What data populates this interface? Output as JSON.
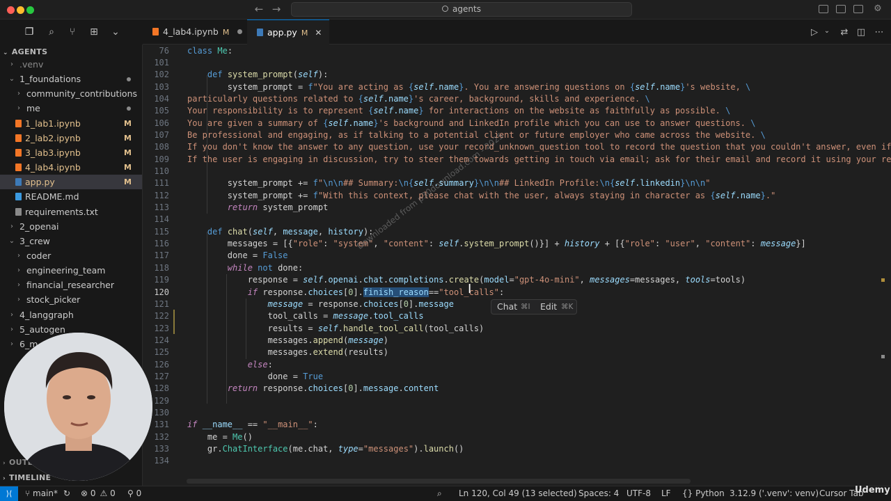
{
  "window": {
    "search_label": "agents"
  },
  "sidebar": {
    "section_title": "AGENTS",
    "outline_label": "OUTL...",
    "timeline_label": "TIMELINE",
    "items": [
      {
        "label": ".venv",
        "depth": 1,
        "kind": "folder",
        "open": false,
        "dim": true
      },
      {
        "label": "1_foundations",
        "depth": 1,
        "kind": "folder",
        "open": true,
        "dot": true
      },
      {
        "label": "community_contributions",
        "depth": 2,
        "kind": "folder",
        "open": false
      },
      {
        "label": "me",
        "depth": 2,
        "kind": "folder",
        "open": false,
        "dot": true
      },
      {
        "label": "1_lab1.ipynb",
        "depth": 2,
        "kind": "notebook",
        "badge": "M"
      },
      {
        "label": "2_lab2.ipynb",
        "depth": 2,
        "kind": "notebook",
        "badge": "M"
      },
      {
        "label": "3_lab3.ipynb",
        "depth": 2,
        "kind": "notebook",
        "badge": "M"
      },
      {
        "label": "4_lab4.ipynb",
        "depth": 2,
        "kind": "notebook",
        "badge": "M"
      },
      {
        "label": "app.py",
        "depth": 2,
        "kind": "python",
        "badge": "M",
        "selected": true
      },
      {
        "label": "README.md",
        "depth": 2,
        "kind": "info"
      },
      {
        "label": "requirements.txt",
        "depth": 2,
        "kind": "text"
      },
      {
        "label": "2_openai",
        "depth": 1,
        "kind": "folder",
        "open": false
      },
      {
        "label": "3_crew",
        "depth": 1,
        "kind": "folder",
        "open": true
      },
      {
        "label": "coder",
        "depth": 2,
        "kind": "folder",
        "open": false
      },
      {
        "label": "engineering_team",
        "depth": 2,
        "kind": "folder",
        "open": false
      },
      {
        "label": "financial_researcher",
        "depth": 2,
        "kind": "folder",
        "open": false
      },
      {
        "label": "stock_picker",
        "depth": 2,
        "kind": "folder",
        "open": false
      },
      {
        "label": "4_langgraph",
        "depth": 1,
        "kind": "folder",
        "open": false
      },
      {
        "label": "5_autogen",
        "depth": 1,
        "kind": "folder",
        "open": false
      },
      {
        "label": "6_m",
        "depth": 1,
        "kind": "folder",
        "open": false
      }
    ]
  },
  "tabs": [
    {
      "label": "4_lab4.ipynb",
      "mod": "M",
      "kind": "notebook",
      "active": false
    },
    {
      "label": "app.py",
      "mod": "M",
      "kind": "python",
      "active": true
    }
  ],
  "hover_hint": {
    "chat": "Chat",
    "chat_key": "⌘I",
    "edit": "Edit",
    "edit_key": "⌘K"
  },
  "watermark": "Downloaded from p30download.com - 2025",
  "status": {
    "branch": "main*",
    "errors": "0",
    "warnings": "0",
    "ports": "0",
    "position": "Ln 120, Col 49 (13 selected)",
    "spaces": "Spaces: 4",
    "encoding": "UTF-8",
    "eol": "LF",
    "language": "Python",
    "interpreter": "3.12.9 ('.venv': venv)",
    "cursor_tab": "Cursor Tab"
  },
  "branding": "Udemy",
  "colors": {
    "accent": "#0078d4",
    "modified": "#e2c08d",
    "editor_bg": "#1f1f1f",
    "sidebar_bg": "#181818"
  }
}
